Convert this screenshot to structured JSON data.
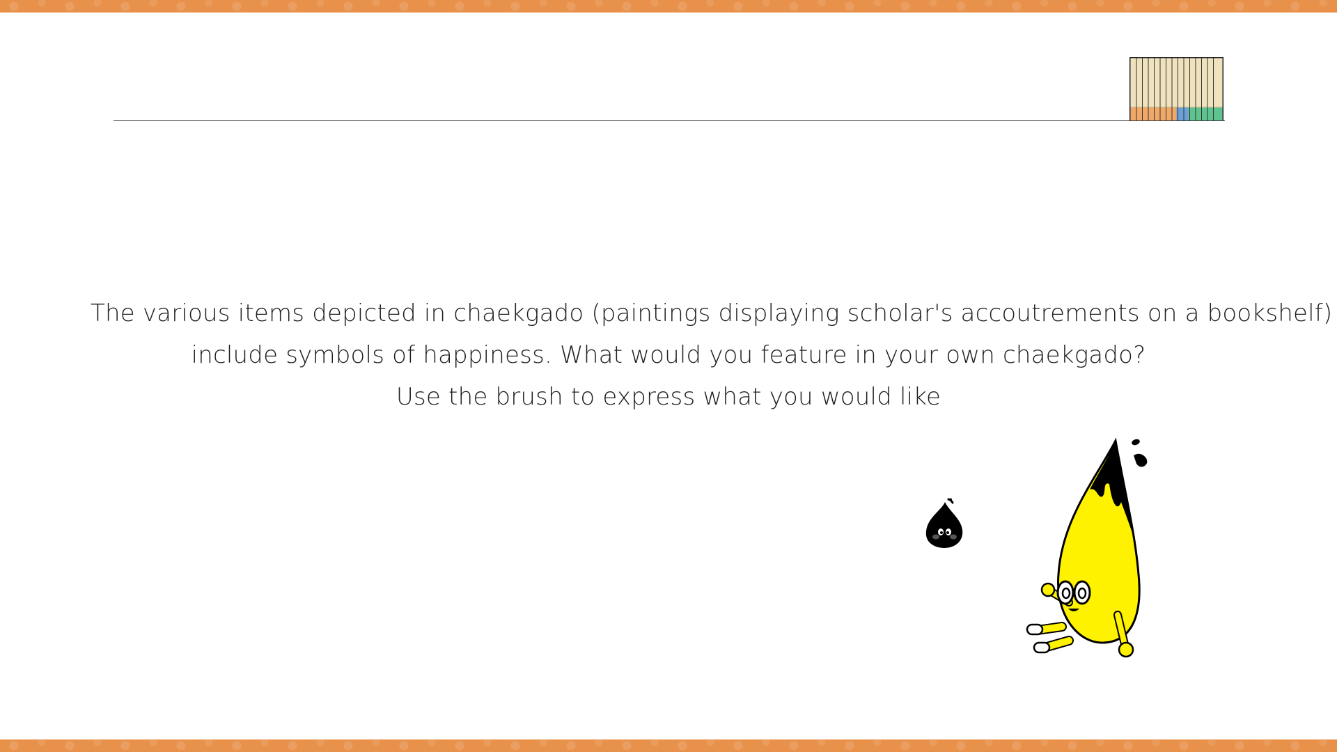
{
  "prompt": {
    "line1": "The various items depicted in chaekgado (paintings displaying scholar's accoutrements on a bookshelf)",
    "line2": "include symbols of happiness. What would you feature in your own chaekgado?",
    "line3": "Use the brush to express what you would like"
  },
  "colors": {
    "band": "#e8914b",
    "rule": "#333333",
    "text": "#1f1f1f",
    "shelf_body": "#efe2bd",
    "shelf_orange": "#f0a868",
    "shelf_blue": "#6b9fd8",
    "shelf_green": "#5fc38f",
    "brush_yellow": "#fff200",
    "ink_black": "#000000"
  },
  "icons": {
    "bookshelf": "bookshelf-icon",
    "ink_drop": "ink-drop-character",
    "brush": "brush-character"
  }
}
